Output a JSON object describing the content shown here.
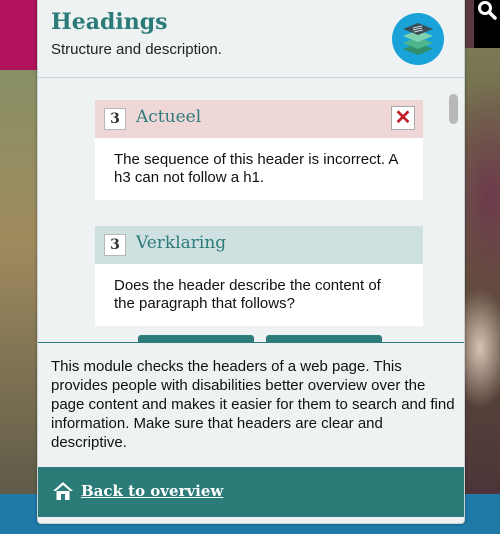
{
  "module": {
    "title": "Headings",
    "subtitle": "Structure and description.",
    "icon": "stacked-layers-icon",
    "description": "This module checks the headers of a web page. This provides people with disabilities better overview over the page content and makes it easier for them to search and find information. Make sure that headers are clear and descriptive."
  },
  "results": [
    {
      "level": "3",
      "label": "Actueel",
      "status": "error",
      "message": "The sequence of this header is incorrect. A h3 can not follow a h1.",
      "close_icon": "close-x-icon"
    },
    {
      "level": "3",
      "label": "Verklaring",
      "status": "question",
      "message": "Does the header describe the content of the paragraph that follows?"
    }
  ],
  "footer": {
    "icon": "home-icon",
    "back_label": "Back to overview"
  },
  "colors": {
    "accent": "#2b7c79",
    "error_bg": "#efd7d8",
    "info_bg": "#cfe0e1",
    "icon_circle": "#1aa3d8",
    "error_x": "#c21e2a"
  }
}
